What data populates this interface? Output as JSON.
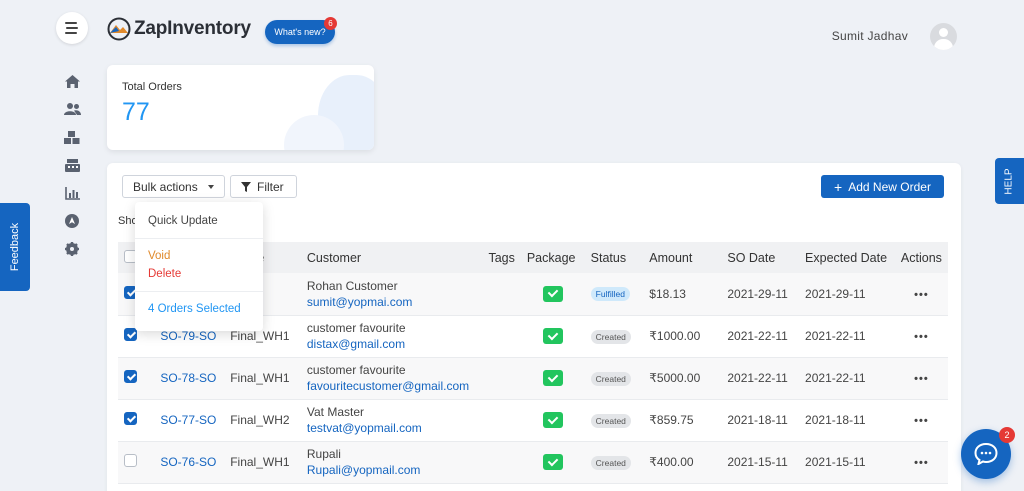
{
  "brand": {
    "name": "ZapInventory",
    "accent": "#1565c0"
  },
  "header": {
    "whats_new_label": "What's new?",
    "whats_new_badge": "6",
    "user_name": "Sumit Jadhav"
  },
  "sidebar": {
    "icons": [
      "home-icon",
      "users-icon",
      "warehouse-icon",
      "cash-register-icon",
      "reports-icon",
      "compass-icon",
      "settings-icon"
    ]
  },
  "feedback_label": "Feedback",
  "help_label": "HELP",
  "stats": {
    "label": "Total Orders",
    "value": "77"
  },
  "toolbar": {
    "bulk_actions_label": "Bulk actions",
    "filter_label": "Filter",
    "add_new_label": "Add New Order"
  },
  "showing_text": "Sho",
  "bulk_menu": {
    "quick_update": "Quick Update",
    "void": "Void",
    "delete": "Delete",
    "selected": "4 Orders Selected"
  },
  "table": {
    "headers": {
      "warehouse": "house",
      "customer": "Customer",
      "tags": "Tags",
      "package": "Package",
      "status": "Status",
      "amount": "Amount",
      "so_date": "SO Date",
      "expected_date": "Expected Date",
      "actions": "Actions"
    },
    "rows": [
      {
        "checked": true,
        "so": "",
        "warehouse": "WH1",
        "customer_name": "Rohan Customer",
        "customer_email": "sumit@yopmai.com",
        "status": "Fulfilled",
        "amount": "$18.13",
        "so_date": "2021-29-11",
        "expected_date": "2021-29-11"
      },
      {
        "checked": true,
        "so": "SO-79-SO",
        "warehouse": "Final_WH1",
        "customer_name": "customer favourite",
        "customer_email": "distax@gmail.com",
        "status": "Created",
        "amount": "₹1000.00",
        "so_date": "2021-22-11",
        "expected_date": "2021-22-11"
      },
      {
        "checked": true,
        "so": "SO-78-SO",
        "warehouse": "Final_WH1",
        "customer_name": "customer favourite",
        "customer_email": "favouritecustomer@gmail.com",
        "status": "Created",
        "amount": "₹5000.00",
        "so_date": "2021-22-11",
        "expected_date": "2021-22-11"
      },
      {
        "checked": true,
        "so": "SO-77-SO",
        "warehouse": "Final_WH2",
        "customer_name": "Vat Master",
        "customer_email": "testvat@yopmail.com",
        "status": "Created",
        "amount": "₹859.75",
        "so_date": "2021-18-11",
        "expected_date": "2021-18-11"
      },
      {
        "checked": false,
        "so": "SO-76-SO",
        "warehouse": "Final_WH1",
        "customer_name": "Rupali",
        "customer_email": "Rupali@yopmail.com",
        "status": "Created",
        "amount": "₹400.00",
        "so_date": "2021-15-11",
        "expected_date": "2021-15-11"
      }
    ],
    "actions_glyph": "•••"
  },
  "chat": {
    "badge": "2"
  }
}
